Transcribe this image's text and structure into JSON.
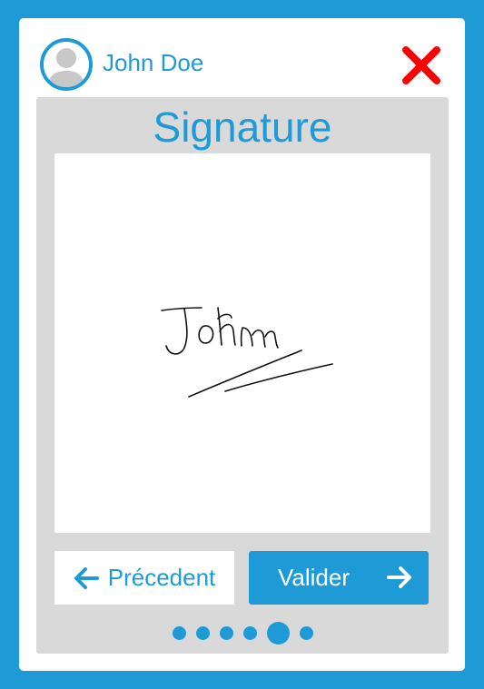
{
  "header": {
    "user_name": "John Doe",
    "avatar_icon": "user-avatar-icon",
    "close_icon": "close-x-icon"
  },
  "panel": {
    "title": "Signature",
    "signature_text": "John"
  },
  "navigation": {
    "prev_label": "Précedent",
    "prev_icon": "arrow-left-icon",
    "next_label": "Valider",
    "next_icon": "arrow-right-icon"
  },
  "pagination": {
    "total_steps": 6,
    "current_step": 5
  },
  "colors": {
    "accent": "#1e9bd7",
    "panel_bg": "#d9d9d9",
    "close": "#ff0000",
    "avatar_gray": "#c8c8c8"
  }
}
